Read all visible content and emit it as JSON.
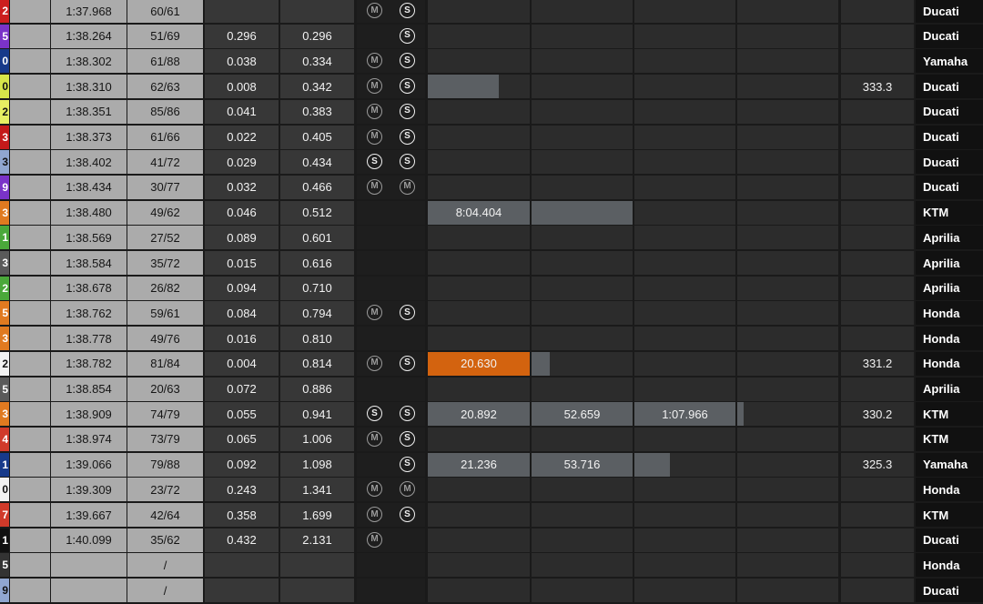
{
  "colors": {
    "gray_cell": "#ababab",
    "dark_cell": "#373737",
    "sector_bar": "#5b5f63",
    "orange": "#d3630f"
  },
  "rows": [
    {
      "num": "2",
      "color": "#cc1e1e",
      "numcolor": "#ffffff",
      "best": "1:37.968",
      "laps": "60/61",
      "gap": "",
      "int": "",
      "t1": "M",
      "t2": "S",
      "s1": "",
      "s2": "",
      "s3": "",
      "speed": "",
      "mfr": "Ducati"
    },
    {
      "num": "5",
      "color": "#7a33c8",
      "numcolor": "#ffffff",
      "best": "1:38.264",
      "laps": "51/69",
      "gap": "0.296",
      "int": "0.296",
      "t1": "",
      "t2": "S",
      "s1": "",
      "s2": "",
      "s3": "",
      "speed": "",
      "mfr": "Ducati"
    },
    {
      "num": "0",
      "color": "#173a8a",
      "numcolor": "#ffffff",
      "best": "1:38.302",
      "laps": "61/88",
      "gap": "0.038",
      "int": "0.334",
      "t1": "M",
      "t2": "S",
      "s1": "",
      "s2": "",
      "s3": "",
      "speed": "",
      "mfr": "Yamaha"
    },
    {
      "num": "0",
      "color": "#d7e64a",
      "numcolor": "#111111",
      "best": "1:38.310",
      "laps": "62/63",
      "gap": "0.008",
      "int": "0.342",
      "t1": "M",
      "t2": "S",
      "s1": "",
      "s2": "",
      "s3": "",
      "speed": "333.3",
      "mfr": "Ducati",
      "bars": [
        {
          "sector": 0,
          "fill": 0.7,
          "color": "#5b5f63",
          "text": ""
        }
      ]
    },
    {
      "num": "2",
      "color": "#e6ee62",
      "numcolor": "#111111",
      "best": "1:38.351",
      "laps": "85/86",
      "gap": "0.041",
      "int": "0.383",
      "t1": "M",
      "t2": "S",
      "s1": "",
      "s2": "",
      "s3": "",
      "speed": "",
      "mfr": "Ducati"
    },
    {
      "num": "3",
      "color": "#c41a1a",
      "numcolor": "#ffffff",
      "best": "1:38.373",
      "laps": "61/66",
      "gap": "0.022",
      "int": "0.405",
      "t1": "M",
      "t2": "S",
      "s1": "",
      "s2": "",
      "s3": "",
      "speed": "",
      "mfr": "Ducati"
    },
    {
      "num": "3",
      "color": "#90a6d0",
      "numcolor": "#111111",
      "best": "1:38.402",
      "laps": "41/72",
      "gap": "0.029",
      "int": "0.434",
      "t1": "S",
      "t2": "S",
      "s1": "",
      "s2": "",
      "s3": "",
      "speed": "",
      "mfr": "Ducati"
    },
    {
      "num": "9",
      "color": "#7a33c8",
      "numcolor": "#ffffff",
      "best": "1:38.434",
      "laps": "30/77",
      "gap": "0.032",
      "int": "0.466",
      "t1": "M",
      "t2": "M",
      "s1": "",
      "s2": "",
      "s3": "",
      "speed": "",
      "mfr": "Ducati"
    },
    {
      "num": "3",
      "color": "#e07a20",
      "numcolor": "#ffffff",
      "best": "1:38.480",
      "laps": "49/62",
      "gap": "0.046",
      "int": "0.512",
      "t1": "",
      "t2": "",
      "s1": "8:04.404",
      "s2": "",
      "s3": "",
      "speed": "",
      "mfr": "KTM",
      "bars": [
        {
          "sector": 0,
          "fill": 1,
          "color": "#5b5f63",
          "text": "8:04.404"
        },
        {
          "sector": 1,
          "fill": 1,
          "color": "#5b5f63",
          "text": ""
        }
      ]
    },
    {
      "num": "1",
      "color": "#4aa83a",
      "numcolor": "#ffffff",
      "best": "1:38.569",
      "laps": "27/52",
      "gap": "0.089",
      "int": "0.601",
      "t1": "",
      "t2": "",
      "s1": "",
      "s2": "",
      "s3": "",
      "speed": "",
      "mfr": "Aprilia"
    },
    {
      "num": "3",
      "color": "#5a5a5a",
      "numcolor": "#ffffff",
      "best": "1:38.584",
      "laps": "35/72",
      "gap": "0.015",
      "int": "0.616",
      "t1": "",
      "t2": "",
      "s1": "",
      "s2": "",
      "s3": "",
      "speed": "",
      "mfr": "Aprilia"
    },
    {
      "num": "2",
      "color": "#4aa83a",
      "numcolor": "#ffffff",
      "best": "1:38.678",
      "laps": "26/82",
      "gap": "0.094",
      "int": "0.710",
      "t1": "",
      "t2": "",
      "s1": "",
      "s2": "",
      "s3": "",
      "speed": "",
      "mfr": "Aprilia"
    },
    {
      "num": "5",
      "color": "#e07a20",
      "numcolor": "#ffffff",
      "best": "1:38.762",
      "laps": "59/61",
      "gap": "0.084",
      "int": "0.794",
      "t1": "M",
      "t2": "S",
      "s1": "",
      "s2": "",
      "s3": "",
      "speed": "",
      "mfr": "Honda"
    },
    {
      "num": "3",
      "color": "#e07a20",
      "numcolor": "#ffffff",
      "best": "1:38.778",
      "laps": "49/76",
      "gap": "0.016",
      "int": "0.810",
      "t1": "",
      "t2": "",
      "s1": "",
      "s2": "",
      "s3": "",
      "speed": "",
      "mfr": "Honda"
    },
    {
      "num": "2",
      "color": "#f2f2f2",
      "numcolor": "#111111",
      "best": "1:38.782",
      "laps": "81/84",
      "gap": "0.004",
      "int": "0.814",
      "t1": "M",
      "t2": "S",
      "s1": "20.630",
      "s2": "",
      "s3": "",
      "speed": "331.2",
      "mfr": "Honda",
      "bars": [
        {
          "sector": 0,
          "fill": 1,
          "color": "#d3630f",
          "text": "20.630"
        },
        {
          "sector": 1,
          "fill": 0.18,
          "color": "#5b5f63",
          "text": ""
        }
      ]
    },
    {
      "num": "5",
      "color": "#5a5a5a",
      "numcolor": "#ffffff",
      "best": "1:38.854",
      "laps": "20/63",
      "gap": "0.072",
      "int": "0.886",
      "t1": "",
      "t2": "",
      "s1": "",
      "s2": "",
      "s3": "",
      "speed": "",
      "mfr": "Aprilia"
    },
    {
      "num": "3",
      "color": "#e07a20",
      "numcolor": "#ffffff",
      "best": "1:38.909",
      "laps": "74/79",
      "gap": "0.055",
      "int": "0.941",
      "t1": "S",
      "t2": "S",
      "s1": "20.892",
      "s2": "52.659",
      "s3": "1:07.966",
      "speed": "330.2",
      "mfr": "KTM",
      "bars": [
        {
          "sector": 0,
          "fill": 1,
          "color": "#5b5f63",
          "text": "20.892"
        },
        {
          "sector": 1,
          "fill": 1,
          "color": "#5b5f63",
          "text": "52.659"
        },
        {
          "sector": 2,
          "fill": 1,
          "color": "#5b5f63",
          "text": "1:07.966"
        },
        {
          "sector": 3,
          "fill": 0.06,
          "color": "#5b5f63",
          "text": ""
        }
      ]
    },
    {
      "num": "4",
      "color": "#d03a2a",
      "numcolor": "#ffffff",
      "best": "1:38.974",
      "laps": "73/79",
      "gap": "0.065",
      "int": "1.006",
      "t1": "M",
      "t2": "S",
      "s1": "",
      "s2": "",
      "s3": "",
      "speed": "",
      "mfr": "KTM"
    },
    {
      "num": "1",
      "color": "#173a8a",
      "numcolor": "#ffffff",
      "best": "1:39.066",
      "laps": "79/88",
      "gap": "0.092",
      "int": "1.098",
      "t1": "",
      "t2": "S",
      "s1": "21.236",
      "s2": "53.716",
      "s3": "",
      "speed": "325.3",
      "mfr": "Yamaha",
      "bars": [
        {
          "sector": 0,
          "fill": 1,
          "color": "#5b5f63",
          "text": "21.236"
        },
        {
          "sector": 1,
          "fill": 1,
          "color": "#5b5f63",
          "text": "53.716"
        },
        {
          "sector": 2,
          "fill": 0.35,
          "color": "#5b5f63",
          "text": ""
        }
      ]
    },
    {
      "num": "0",
      "color": "#f2f2f2",
      "numcolor": "#111111",
      "best": "1:39.309",
      "laps": "23/72",
      "gap": "0.243",
      "int": "1.341",
      "t1": "M",
      "t2": "M",
      "s1": "",
      "s2": "",
      "s3": "",
      "speed": "",
      "mfr": "Honda"
    },
    {
      "num": "7",
      "color": "#d03a2a",
      "numcolor": "#ffffff",
      "best": "1:39.667",
      "laps": "42/64",
      "gap": "0.358",
      "int": "1.699",
      "t1": "M",
      "t2": "S",
      "s1": "",
      "s2": "",
      "s3": "",
      "speed": "",
      "mfr": "KTM"
    },
    {
      "num": "1",
      "color": "#111111",
      "numcolor": "#ffffff",
      "best": "1:40.099",
      "laps": "35/62",
      "gap": "0.432",
      "int": "2.131",
      "t1": "M",
      "t2": "",
      "s1": "",
      "s2": "",
      "s3": "",
      "speed": "",
      "mfr": "Ducati"
    },
    {
      "num": "5",
      "color": "#333333",
      "numcolor": "#ffffff",
      "best": "",
      "laps": "/",
      "gap": "",
      "int": "",
      "t1": "",
      "t2": "",
      "s1": "",
      "s2": "",
      "s3": "",
      "speed": "",
      "mfr": "Honda"
    },
    {
      "num": "9",
      "color": "#90a6d0",
      "numcolor": "#111111",
      "best": "",
      "laps": "/",
      "gap": "",
      "int": "",
      "t1": "",
      "t2": "",
      "s1": "",
      "s2": "",
      "s3": "",
      "speed": "",
      "mfr": "Ducati"
    }
  ]
}
